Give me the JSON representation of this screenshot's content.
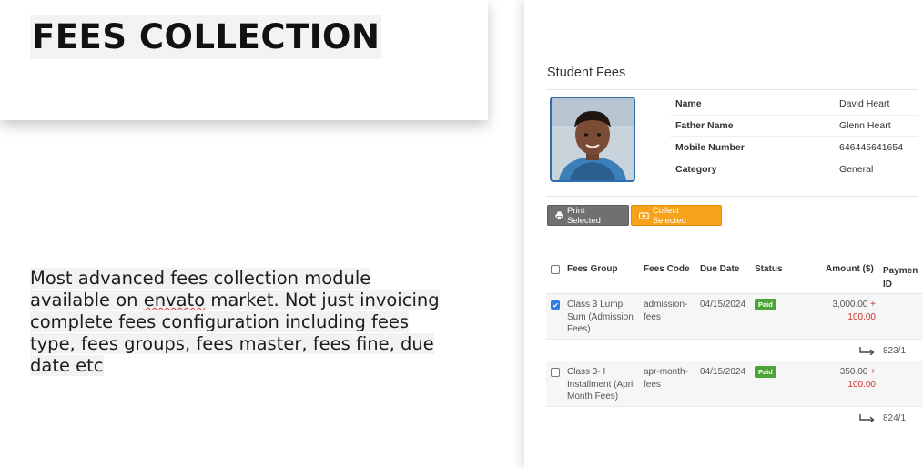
{
  "promo": {
    "title": "FEES COLLECTION",
    "description": {
      "line1": "Most advanced fees collection module",
      "line2_a": "available on ",
      "line2_spell": "envato",
      "line2_b": " market. Not just invoicing",
      "line3": "complete fees configuration including fees",
      "line4": "type, fees groups, fees master, fees fine, due",
      "line5": "date etc"
    }
  },
  "panel": {
    "title": "Student Fees",
    "photo_icon": "student-photo",
    "student": [
      {
        "label": "Name",
        "value": "David Heart"
      },
      {
        "label": "Father Name",
        "value": "Glenn Heart"
      },
      {
        "label": "Mobile Number",
        "value": "646445641654"
      },
      {
        "label": "Category",
        "value": "General"
      }
    ],
    "buttons": {
      "print": {
        "label": "Print Selected",
        "icon": "printer-icon"
      },
      "collect": {
        "label": "Collect Selected",
        "icon": "money-icon"
      }
    },
    "table": {
      "headers": {
        "group": "Fees Group",
        "code": "Fees Code",
        "due": "Due Date",
        "status": "Status",
        "amount": "Amount ($)",
        "payment_a": "Paymen",
        "payment_b": "ID"
      },
      "rows": [
        {
          "checked": true,
          "group_lines": [
            "Class 3 Lump",
            "Sum (Admission",
            "Fees)"
          ],
          "code_lines": [
            "admission-",
            "fees"
          ],
          "due": "04/15/2024",
          "status": "Paid",
          "amount": "3,000.00",
          "plus": "+",
          "fine": "100.00",
          "payment_id": "823/1"
        },
        {
          "checked": false,
          "group_lines": [
            "Class 3- I",
            "Installment (April",
            "Month Fees)"
          ],
          "code_lines": [
            "apr-month-",
            "fees"
          ],
          "due": "04/15/2024",
          "status": "Paid",
          "amount": "350.00",
          "plus": "+",
          "fine": "100.00",
          "payment_id": "824/1"
        }
      ]
    },
    "colors": {
      "paid_badge": "#4ca336",
      "collect_button": "#f7a21b",
      "print_button": "#707070",
      "fine": "#d03030"
    }
  }
}
